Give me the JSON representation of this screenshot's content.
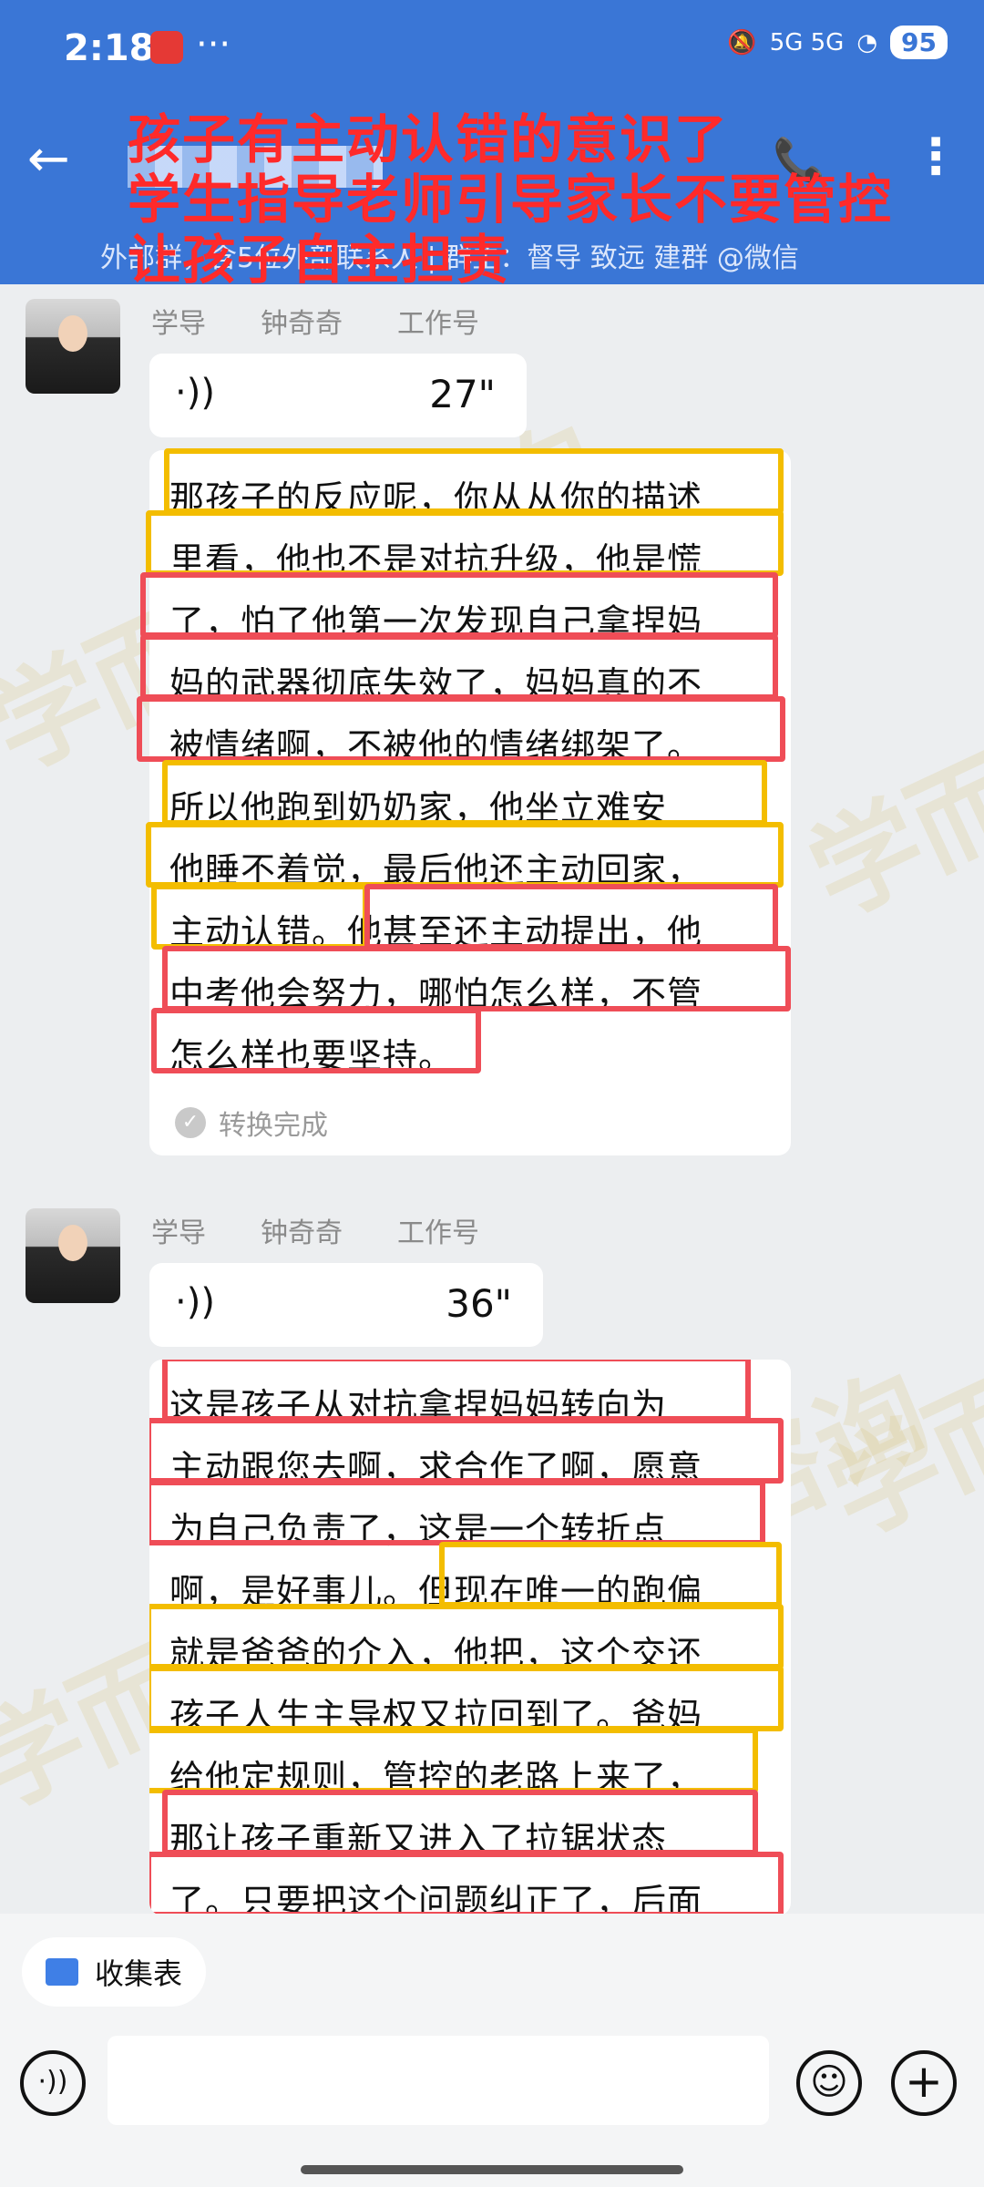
{
  "status_bar": {
    "time": "2:18",
    "more": "···",
    "signal": "5G 5G",
    "battery": "95"
  },
  "header": {
    "back_icon": "←",
    "video_icon": "📞",
    "more_icon": "⋮",
    "subtitle": "外部群，含5位外部联系人 | 群主：督导 致远    建群 @微信"
  },
  "overlay": {
    "line1": "孩子有主动认错的意识了",
    "line2": "学生指导老师引导家长不要管控",
    "line3": "让孩子自主担责"
  },
  "messages": [
    {
      "sender_role": "学导",
      "sender_name": "钟奇奇",
      "sender_tag": "工作号",
      "duration": "27\"",
      "lines": [
        "那孩子的反应呢，你从从你的描述",
        "里看，他也不是对抗升级，他是慌",
        "了，怕了他第一次发现自己拿捏妈",
        "妈的武器彻底失效了，妈妈真的不",
        "被情绪啊，不被他的情绪绑架了。",
        "所以他跑到奶奶家，他坐立难安",
        "他睡不着觉，最后他还主动回家，",
        "主动认错。他甚至还主动提出，他",
        "中考他会努力，哪怕怎么样，不管",
        "怎么样也要坚持。"
      ],
      "status": "转换完成"
    },
    {
      "sender_role": "学导",
      "sender_name": "钟奇奇",
      "sender_tag": "工作号",
      "duration": "36\"",
      "lines": [
        "这是孩子从对抗拿捏妈妈转向为",
        "主动跟您去啊，求合作了啊，愿意",
        "为自己负责了，这是一个转折点",
        "啊，是好事儿。但现在唯一的跑偏",
        "就是爸爸的介入，他把，这个交还",
        "孩子人生主导权又拉回到了。爸妈",
        "给他定规则，管控的老路上来了，",
        "那让孩子重新又进入了拉锯状态",
        "了。只要把这个问题纠正了，后面"
      ]
    }
  ],
  "bottom": {
    "collect_label": "收集表"
  },
  "watermark": "学而教育咨询",
  "colors": {
    "header": "#3a76d6",
    "highlight_yellow": "#f3bd00",
    "highlight_red": "#ef4d57",
    "overlay_red": "#ff2a2a"
  }
}
